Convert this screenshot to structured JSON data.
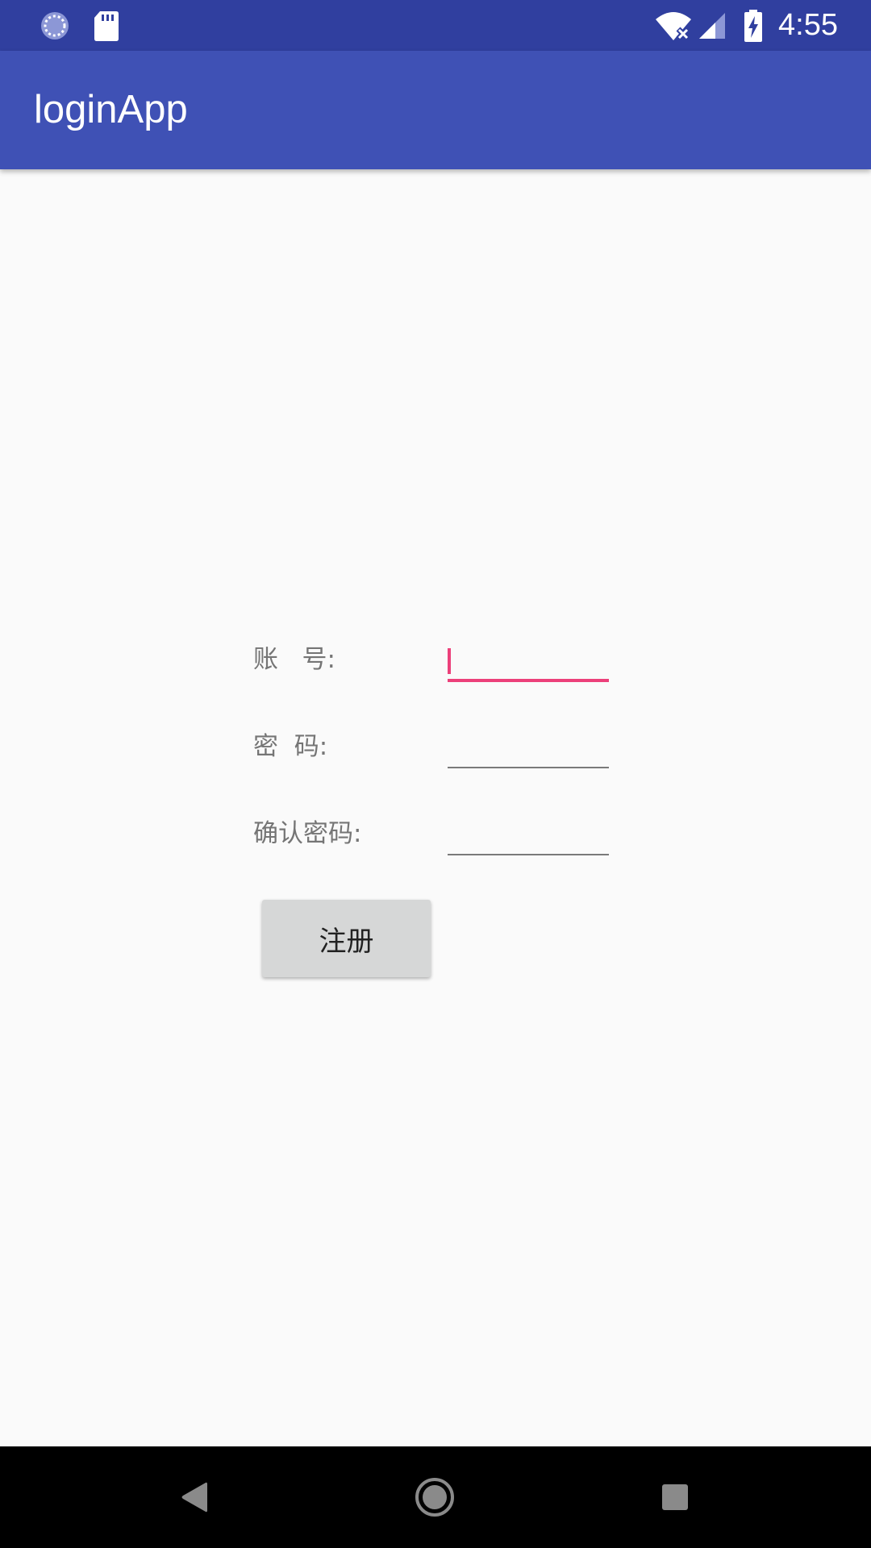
{
  "status_bar": {
    "time": "4:55",
    "icons": [
      "sync-icon",
      "sd-card-icon",
      "wifi-off-icon",
      "signal-icon",
      "battery-charging-icon"
    ]
  },
  "app_bar": {
    "title": "loginApp"
  },
  "form": {
    "account_label": "账   号:",
    "account_value": "",
    "password_label": "密  码:",
    "password_value": "",
    "confirm_label": "确认密码:",
    "confirm_value": "",
    "register_button": "注册"
  },
  "nav_bar": {
    "icons": [
      "back-icon",
      "home-icon",
      "recents-icon"
    ]
  },
  "colors": {
    "status_bar": "#303f9f",
    "app_bar": "#3f51b5",
    "accent": "#ec407a",
    "background": "#fafafa"
  }
}
